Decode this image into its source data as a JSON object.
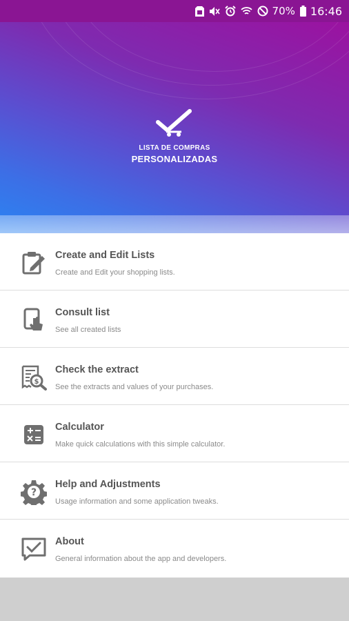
{
  "status_bar": {
    "icons": [
      "sd-card-icon",
      "mute-icon",
      "alarm-icon",
      "wifi-icon",
      "dnd-icon",
      "battery-icon"
    ],
    "battery": "70%",
    "time": "16:46"
  },
  "header": {
    "logo_line1": "LISTA DE COMPRAS",
    "logo_line2": "PERSONALIZADAS"
  },
  "menu": {
    "items": [
      {
        "title": "Create and Edit Lists",
        "subtitle": "Create and Edit your shopping lists.",
        "icon": "edit-list-icon"
      },
      {
        "title": "Consult list",
        "subtitle": "See all created lists",
        "icon": "tablet-touch-icon"
      },
      {
        "title": "Check the extract",
        "subtitle": "See the extracts and values of your purchases.",
        "icon": "receipt-search-icon"
      },
      {
        "title": "Calculator",
        "subtitle": "Make quick calculations with this simple calculator.",
        "icon": "calculator-icon"
      },
      {
        "title": "Help and Adjustments",
        "subtitle": "Usage information and some application tweaks.",
        "icon": "gear-help-icon"
      },
      {
        "title": "About",
        "subtitle": "General information about the app and developers.",
        "icon": "chat-check-icon"
      }
    ]
  },
  "colors": {
    "status_bar": "#8a1593",
    "gradient_top": "#9b12a0",
    "gradient_bottom": "#2b84f2",
    "icon_gray": "#6f6f6f",
    "title_gray": "#555555"
  }
}
